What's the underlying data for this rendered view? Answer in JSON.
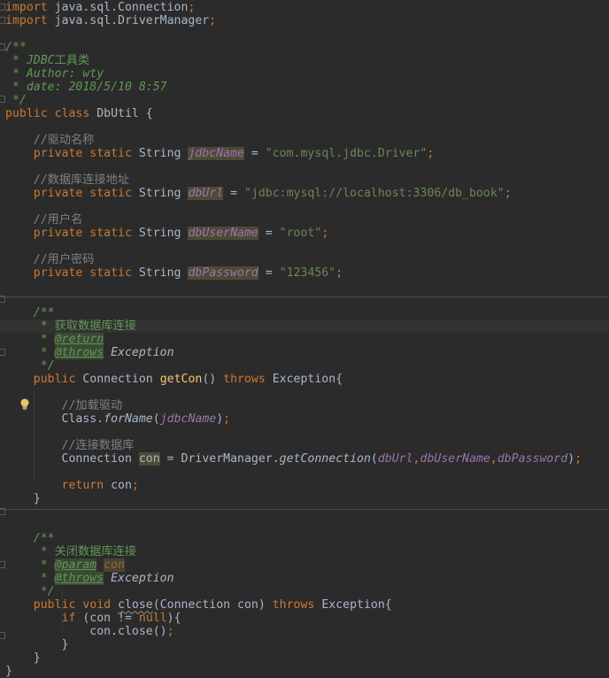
{
  "editor": {
    "theme_colors": {
      "background": "#2B2B2B",
      "keyword": "#CC7832",
      "comment": "#808080",
      "doc_comment": "#629755",
      "string": "#6A8759",
      "field": "#9876AA",
      "method": "#FFC66D",
      "text": "#A9B7C6"
    },
    "current_line": 24,
    "lines": [
      [
        [
          "kw",
          "import "
        ],
        [
          "pl",
          "java.sql.Connection"
        ],
        [
          "kw",
          ";"
        ]
      ],
      [
        [
          "kw",
          "import "
        ],
        [
          "pl",
          "java.sql.DriverManager"
        ],
        [
          "kw",
          ";"
        ]
      ],
      [],
      [
        [
          "doc",
          "/**"
        ]
      ],
      [
        [
          "doc",
          " * JDBC"
        ],
        [
          "doccn",
          "工具类"
        ]
      ],
      [
        [
          "doc",
          " * Author: wty"
        ]
      ],
      [
        [
          "doc",
          " * date: 2018/5/10 8:57"
        ]
      ],
      [
        [
          "doc",
          " */"
        ]
      ],
      [
        [
          "kw",
          "public class "
        ],
        [
          "pl",
          "DbUtil {"
        ]
      ],
      [],
      [
        [
          "cm",
          "    //驱动名称"
        ]
      ],
      [
        [
          "kw",
          "    private static "
        ],
        [
          "pl",
          "String "
        ],
        [
          "fldhl",
          "jdbcName"
        ],
        [
          "pl",
          " = "
        ],
        [
          "str",
          "\"com.mysql.jdbc.Driver\""
        ],
        [
          "kw",
          ";"
        ]
      ],
      [],
      [
        [
          "cm",
          "    //数据库连接地址"
        ]
      ],
      [
        [
          "kw",
          "    private static "
        ],
        [
          "pl",
          "String "
        ],
        [
          "fldhl",
          "dbUrl"
        ],
        [
          "pl",
          " = "
        ],
        [
          "str",
          "\"jdbc:mysql://localhost:3306/db_book\""
        ],
        [
          "kw",
          ";"
        ]
      ],
      [],
      [
        [
          "cm",
          "    //用户名"
        ]
      ],
      [
        [
          "kw",
          "    private static "
        ],
        [
          "pl",
          "String "
        ],
        [
          "fldhl",
          "dbUserName"
        ],
        [
          "pl",
          " = "
        ],
        [
          "str",
          "\"root\""
        ],
        [
          "kw",
          ";"
        ]
      ],
      [],
      [
        [
          "cm",
          "    //用户密码"
        ]
      ],
      [
        [
          "kw",
          "    private static "
        ],
        [
          "pl",
          "String "
        ],
        [
          "fldhl",
          "dbPassword"
        ],
        [
          "pl",
          " = "
        ],
        [
          "str",
          "\"123456\""
        ],
        [
          "kw",
          ";"
        ]
      ],
      [],
      [],
      [
        [
          "doc",
          "    /**"
        ]
      ],
      [
        [
          "doc",
          "     * "
        ],
        [
          "doccn",
          "获取数据库连接"
        ]
      ],
      [
        [
          "doc",
          "     * "
        ],
        [
          "tag",
          "@return"
        ]
      ],
      [
        [
          "doc",
          "     * "
        ],
        [
          "tag",
          "@throws"
        ],
        [
          "docref",
          " Exception"
        ]
      ],
      [
        [
          "doc",
          "     */"
        ]
      ],
      [
        [
          "kw",
          "    public "
        ],
        [
          "pl",
          "Connection "
        ],
        [
          "fn",
          "getCon"
        ],
        [
          "pl",
          "() "
        ],
        [
          "kw",
          "throws "
        ],
        [
          "pl",
          "Exception{"
        ]
      ],
      [],
      [
        [
          "cm",
          "        //加载驱动"
        ]
      ],
      [
        [
          "pl",
          "        Class."
        ],
        [
          "sm",
          "forName"
        ],
        [
          "pl",
          "("
        ],
        [
          "fld",
          "jdbcName"
        ],
        [
          "pl",
          ")"
        ],
        [
          "kw",
          ";"
        ]
      ],
      [],
      [
        [
          "cm",
          "        //连接数据库"
        ]
      ],
      [
        [
          "pl",
          "        Connection "
        ],
        [
          "varhl",
          "con"
        ],
        [
          "pl",
          " = DriverManager."
        ],
        [
          "sm",
          "getConnection"
        ],
        [
          "pl",
          "("
        ],
        [
          "fld",
          "dbUrl"
        ],
        [
          "kw",
          ","
        ],
        [
          "fld",
          "dbUserName"
        ],
        [
          "kw",
          ","
        ],
        [
          "fld",
          "dbPassword"
        ],
        [
          "pl",
          ")"
        ],
        [
          "kw",
          ";"
        ]
      ],
      [],
      [
        [
          "kw",
          "        return "
        ],
        [
          "pl",
          "con"
        ],
        [
          "kw",
          ";"
        ]
      ],
      [
        [
          "pl",
          "    }"
        ]
      ],
      [],
      [],
      [
        [
          "doc",
          "    /**"
        ]
      ],
      [
        [
          "doc",
          "     * "
        ],
        [
          "doccn",
          "关闭数据库连接"
        ]
      ],
      [
        [
          "doc",
          "     * "
        ],
        [
          "tag",
          "@param"
        ],
        [
          "doc",
          " "
        ],
        [
          "parhl",
          "con"
        ]
      ],
      [
        [
          "doc",
          "     * "
        ],
        [
          "tag",
          "@throws"
        ],
        [
          "docref",
          " Exception"
        ]
      ],
      [
        [
          "doc",
          "     */"
        ]
      ],
      [
        [
          "kw",
          "    public void "
        ],
        [
          "warn",
          "close"
        ],
        [
          "pl",
          "(Connection con) "
        ],
        [
          "kw",
          "throws "
        ],
        [
          "pl",
          "Exception{"
        ]
      ],
      [
        [
          "kw",
          "        if "
        ],
        [
          "pl",
          "(con != "
        ],
        [
          "kw",
          "null"
        ],
        [
          "pl",
          "){"
        ]
      ],
      [
        [
          "pl",
          "            con.close()"
        ],
        [
          "kw",
          ";"
        ]
      ],
      [
        [
          "pl",
          "        }"
        ]
      ],
      [
        [
          "pl",
          "    }"
        ]
      ],
      [
        [
          "pl",
          "}"
        ]
      ]
    ]
  }
}
